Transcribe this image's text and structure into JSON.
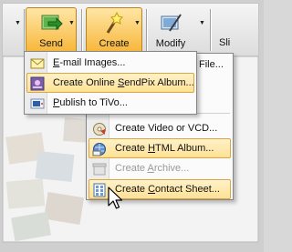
{
  "toolbar": {
    "send_label": "Send",
    "create_label": "Create",
    "modify_label": "Modify",
    "slideshow_label": "Sli"
  },
  "send_menu": {
    "items": [
      {
        "pre": "",
        "key": "E",
        "post": "-mail Images..."
      },
      {
        "pre": "Create Online ",
        "key": "S",
        "post": "endPix Album..."
      },
      {
        "pre": "",
        "key": "P",
        "post": "ublish to TiVo..."
      }
    ]
  },
  "create_menu": {
    "partial_top": "File...",
    "items": [
      {
        "pre": "Create Video or VCD",
        "key": "",
        "post": "...",
        "disabled": false
      },
      {
        "pre": "Create ",
        "key": "H",
        "post": "TML Album...",
        "disabled": false
      },
      {
        "pre": "Create ",
        "key": "A",
        "post": "rchive...",
        "disabled": true
      },
      {
        "pre": "Create ",
        "key": "C",
        "post": "ontact Sheet...",
        "disabled": false
      }
    ]
  },
  "colors": {
    "highlight_top": "#fff2c9",
    "highlight_bottom": "#fde195",
    "active_button": "#f7b73a"
  }
}
